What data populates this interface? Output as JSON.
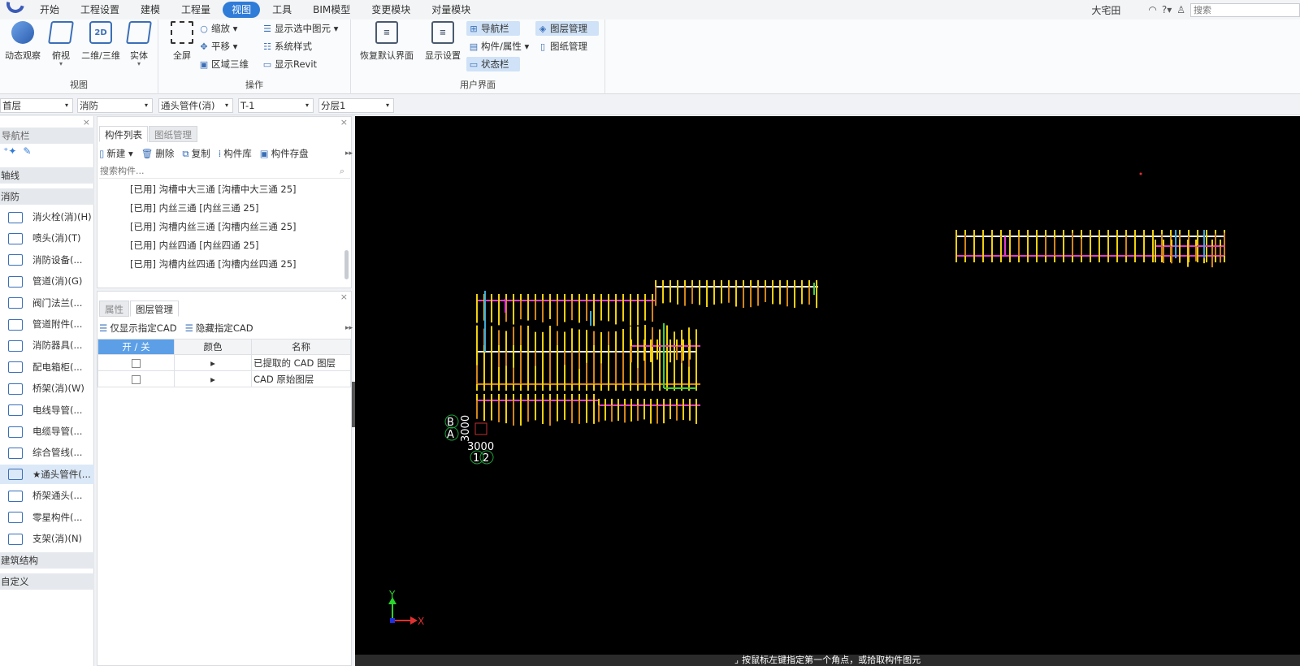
{
  "menu": {
    "items": [
      "开始",
      "工程设置",
      "建模",
      "工程量",
      "视图",
      "工具",
      "BIM模型",
      "变更模块",
      "对量模块"
    ],
    "active": "视图",
    "user": "大宅田",
    "search_placeholder": "搜索"
  },
  "ribbon": {
    "view_group": {
      "label": "视图",
      "orbit": "动态观察",
      "topview": "俯视",
      "toggle2d3d": "二维/三维",
      "solid": "实体",
      "icon_2d": "2D"
    },
    "ops_group": {
      "label": "操作",
      "fullscreen": "全屏",
      "zoom": "缩放",
      "pan": "平移",
      "region3d": "区域三维",
      "show_selected": "显示选中图元",
      "system_style": "系统样式",
      "show_revit": "显示Revit"
    },
    "ui_group": {
      "label": "用户界面",
      "restore": "恢复默认界面",
      "display_settings": "显示设置",
      "navbar": "导航栏",
      "comp_props": "构件/属性",
      "statusbar": "状态栏",
      "layer_mgmt": "图层管理",
      "drawing_mgmt": "图纸管理"
    }
  },
  "dropdowns": {
    "floor": "首层",
    "discipline": "消防",
    "component_type": "通头管件(消)",
    "component": "T-1",
    "layer": "分层1"
  },
  "nav": {
    "title": "导航栏",
    "categories": [
      "轴线",
      "消防",
      "建筑结构",
      "自定义"
    ],
    "items": [
      "消火栓(消)(H)",
      "喷头(消)(T)",
      "消防设备(...",
      "管道(消)(G)",
      "阀门法兰(...",
      "管道附件(...",
      "消防器具(...",
      "配电箱柜(...",
      "桥架(消)(W)",
      "电线导管(...",
      "电缆导管(...",
      "综合管线(...",
      "★通头管件(...",
      "桥架通头(...",
      "零星构件(...",
      "支架(消)(N)"
    ]
  },
  "complist": {
    "tabs": [
      "构件列表",
      "图纸管理"
    ],
    "tools": [
      "新建",
      "删除",
      "复制",
      "构件库",
      "构件存盘"
    ],
    "search_placeholder": "搜索构件...",
    "rows": [
      "[已用] 沟槽中大三通 [沟槽中大三通 25]",
      "[已用] 内丝三通 [内丝三通 25]",
      "[已用] 沟槽内丝三通 [沟槽内丝三通 25]",
      "[已用] 内丝四通 [内丝四通 25]",
      "[已用] 沟槽内丝四通 [沟槽内丝四通 25]"
    ]
  },
  "layers": {
    "tabs": [
      "属性",
      "图层管理"
    ],
    "tools": [
      "仅显示指定CAD",
      "隐藏指定CAD"
    ],
    "headers": [
      "开 / 关",
      "颜色",
      "名称"
    ],
    "rows": [
      "已提取的 CAD 图层",
      "CAD 原始图层"
    ]
  },
  "canvas": {
    "axis_labels": {
      "b": "B",
      "a": "A",
      "dim_v": "3000",
      "dim_h": "3000",
      "one": "1",
      "two": "2"
    },
    "ucs": {
      "x": "X",
      "y": "Y"
    },
    "colors": {
      "background": "#000000",
      "pipe_main": "#f0d010",
      "pipe_white": "#ffffff",
      "pipe_orange": "#d2851a",
      "pipe_magenta": "#e03cc8",
      "pipe_cyan": "#3aa8d8",
      "pipe_green": "#3ad23a",
      "axis_circle": "#1aa03a"
    }
  },
  "status": {
    "text": "按鼠标左键指定第一个角点，或拾取构件图元"
  }
}
